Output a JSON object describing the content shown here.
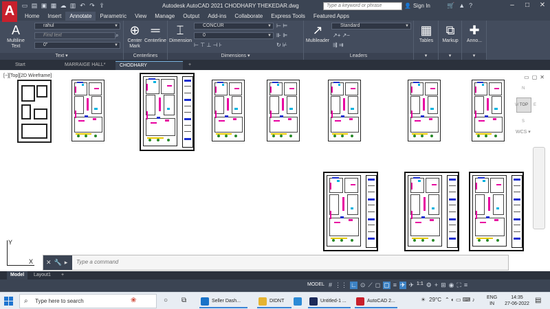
{
  "app": {
    "title": "Autodesk AutoCAD 2021    CHODHARY THEKEDAR.dwg",
    "logo": "A",
    "search_placeholder": "Type a keyword or phrase",
    "signin": "Sign In"
  },
  "menu_tabs": [
    "Home",
    "Insert",
    "Annotate",
    "Parametric",
    "View",
    "Manage",
    "Output",
    "Add-ins",
    "Collaborate",
    "Express Tools",
    "Featured Apps"
  ],
  "active_menu_tab": "Annotate",
  "ribbon": {
    "text_panel": {
      "title": "Text",
      "multiline_text": "Multiline Text",
      "style_value": "rahul",
      "find_text_placeholder": "Find text",
      "height_value": "0\""
    },
    "centerlines_panel": {
      "title": "Centerlines",
      "center_mark": "Center Mark",
      "centerline": "Centerline"
    },
    "dimensions_panel": {
      "title": "Dimensions",
      "dimension": "Dimension",
      "dim_style": "CONCUR",
      "dim_layer": "0"
    },
    "leaders_panel": {
      "title": "Leaders",
      "multileader": "Multileader",
      "leader_style": "Standard"
    },
    "tables": "Tables",
    "markup": "Markup",
    "annotation": "Anno..."
  },
  "doc_tabs": [
    {
      "label": "Start",
      "active": false
    },
    {
      "label": "MARRAIGE HALL*",
      "active": false
    },
    {
      "label": "CHODHARY THEKEDAR*",
      "active": true
    }
  ],
  "viewport_label": "[−][Top][2D Wireframe]",
  "viewcube": {
    "face": "TOP",
    "n": "N",
    "s": "S",
    "w": "W",
    "e": "E",
    "wcs": "WCS"
  },
  "ucs": {
    "x": "X",
    "y": "Y"
  },
  "command": {
    "placeholder": "Type a command"
  },
  "layout_tabs": [
    {
      "label": "Model",
      "active": true
    },
    {
      "label": "Layout1",
      "active": false
    }
  ],
  "status": {
    "mode": "MODEL",
    "scale": "1:1"
  },
  "taskbar": {
    "search_placeholder": "Type here to search",
    "items": [
      {
        "label": "Seller Dash...",
        "icon": "edge-icon",
        "color": "#1a73c8"
      },
      {
        "label": "DIDNT GOT",
        "icon": "folder-icon",
        "color": "#e5b331"
      },
      {
        "label": "",
        "icon": "photos-icon",
        "color": "#2b8ad6"
      },
      {
        "label": "Untitled-1 ...",
        "icon": "photoshop-icon",
        "color": "#1b2a5a"
      },
      {
        "label": "AutoCAD 2...",
        "icon": "autocad-icon",
        "color": "#c8202c"
      }
    ],
    "weather": "29°C",
    "lang": "ENG",
    "region": "IN",
    "time": "14:35",
    "date": "27-06-2022"
  }
}
